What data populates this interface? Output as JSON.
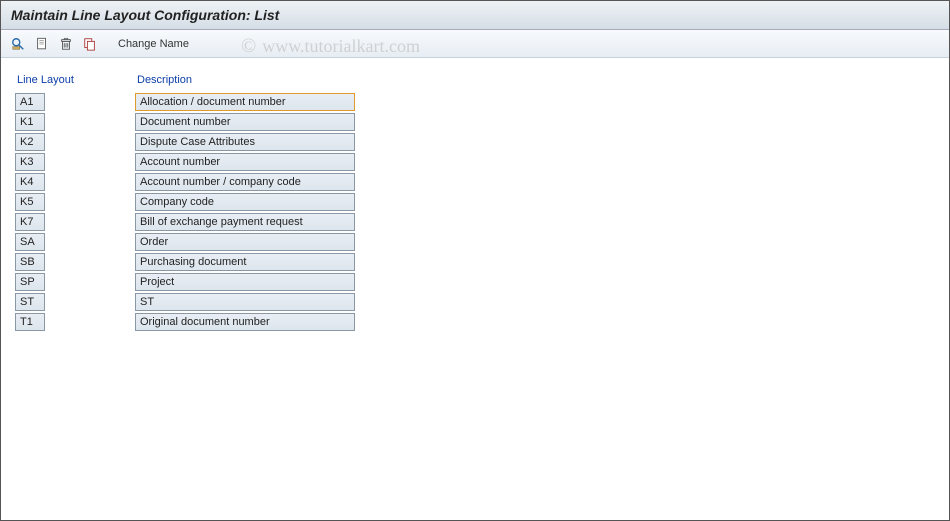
{
  "title": "Maintain Line Layout Configuration: List",
  "toolbar": {
    "change_name": "Change Name"
  },
  "headers": {
    "line_layout": "Line Layout",
    "description": "Description"
  },
  "rows": [
    {
      "code": "A1",
      "desc": "Allocation / document number",
      "selected": true
    },
    {
      "code": "K1",
      "desc": "Document number"
    },
    {
      "code": "K2",
      "desc": "Dispute Case Attributes"
    },
    {
      "code": "K3",
      "desc": "Account number"
    },
    {
      "code": "K4",
      "desc": "Account number / company code"
    },
    {
      "code": "K5",
      "desc": "Company code"
    },
    {
      "code": "K7",
      "desc": "Bill of exchange payment request"
    },
    {
      "code": "SA",
      "desc": "Order"
    },
    {
      "code": "SB",
      "desc": "Purchasing document"
    },
    {
      "code": "SP",
      "desc": "Project"
    },
    {
      "code": "ST",
      "desc": "ST"
    },
    {
      "code": "T1",
      "desc": "Original document number"
    }
  ],
  "watermark": {
    "symbol": "©",
    "text": "www.tutorialkart.com"
  }
}
